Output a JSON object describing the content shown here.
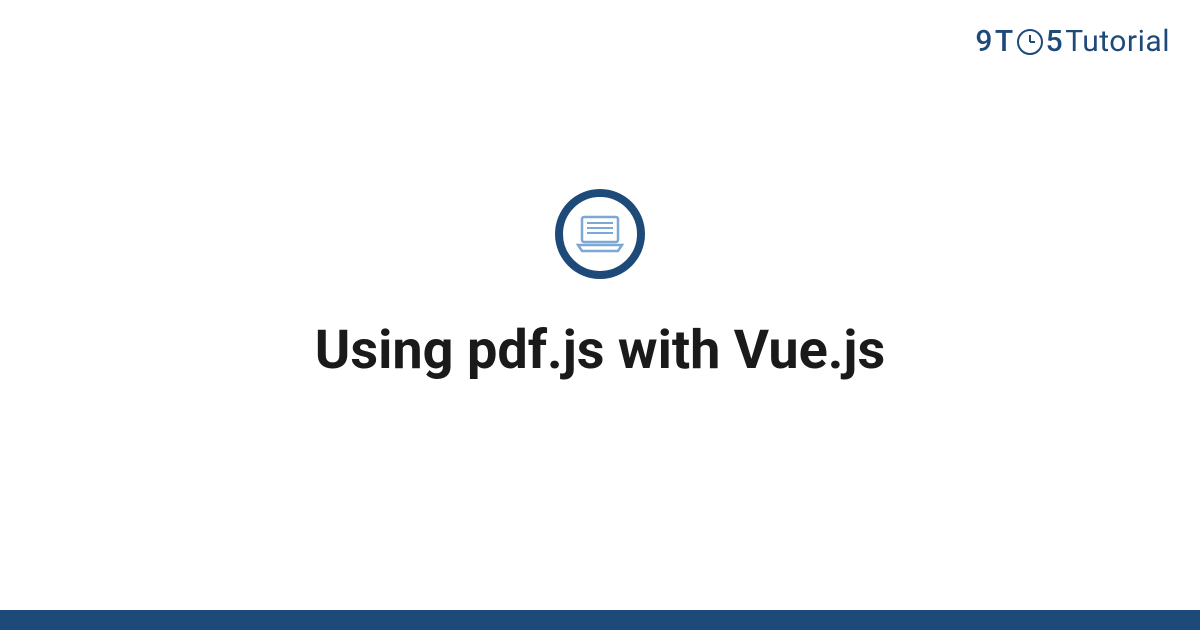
{
  "logo": {
    "part1": "9",
    "part2": "T",
    "part3": "5",
    "part4": "Tutorial"
  },
  "title": "Using pdf.js with Vue.js",
  "colors": {
    "primary": "#1e4a7a",
    "iconAccent": "#7ba8d4"
  }
}
